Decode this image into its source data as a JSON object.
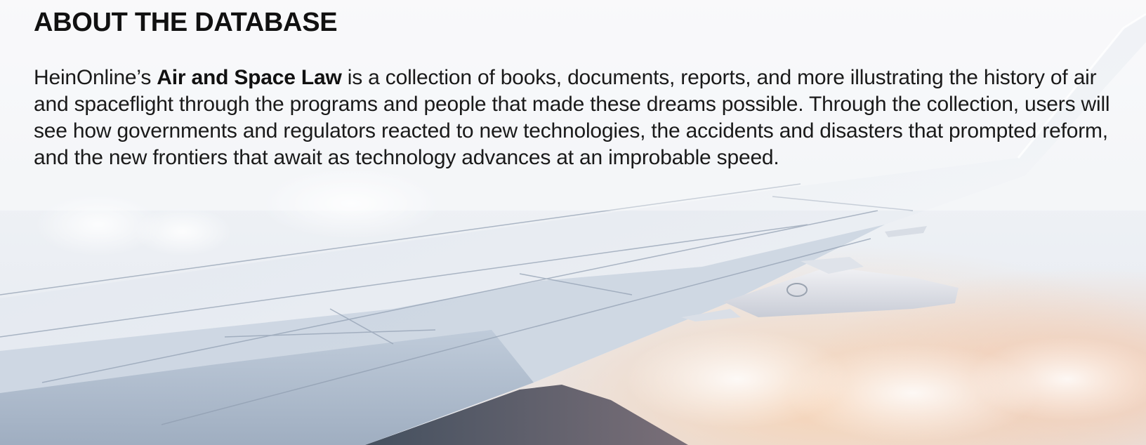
{
  "section": {
    "heading": "ABOUT THE DATABASE",
    "intro": "HeinOnline’s ",
    "collection_name": "Air and Space Law",
    "body": " is a collection of books, documents, reports, and more illustrating the history of air and spaceflight through the programs and people that made these dreams possible. Through the collection, users will see how governments and regulators reacted to new technologies, the accidents and disasters that prompted reform, and the new frontiers that await as technology advances at an improbable speed."
  },
  "background": {
    "subject": "airplane wing above clouds",
    "colors": {
      "sky_top": "#f4f5f8",
      "sky_mid": "#e7ebf1",
      "cloud_warm": "#f6d8bd",
      "wing_light": "#e9edf3",
      "wing_mid": "#c9d3df",
      "wing_dark": "#7e8ea3",
      "engine_dark": "#4f5d70"
    }
  }
}
